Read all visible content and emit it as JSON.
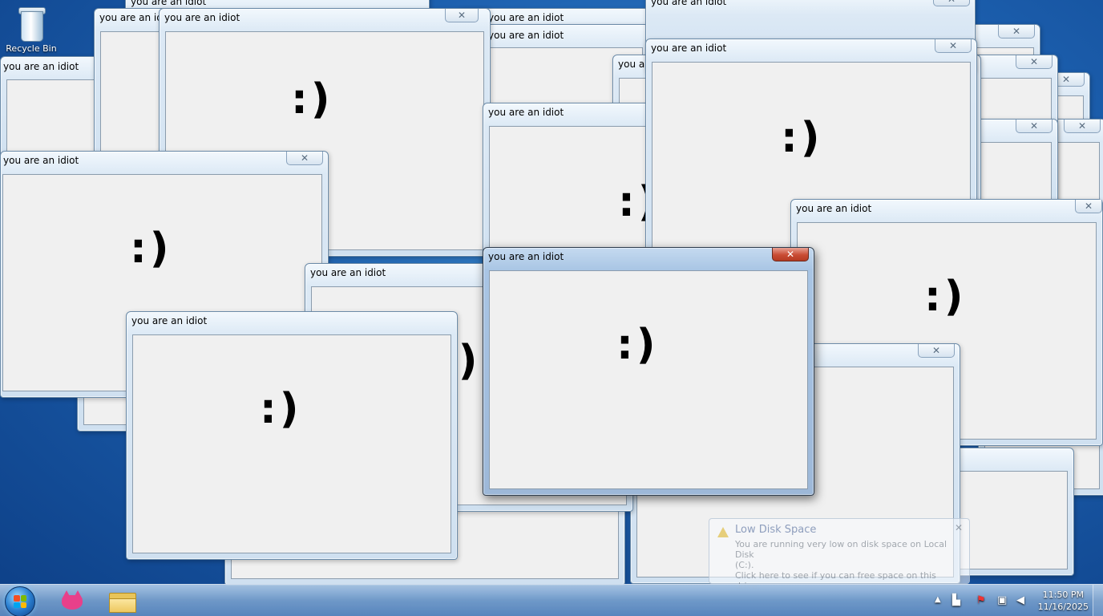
{
  "desktop": {
    "icons": [
      {
        "label": "Recycle Bin",
        "icon": "recycle-bin-icon"
      }
    ]
  },
  "window_title": "you are an idiot",
  "smiley": ":)",
  "close_glyph": "✕",
  "notification": {
    "title": "Low Disk Space",
    "line1": "You are running very low on disk space on Local Disk",
    "line2": "(C:).",
    "line3": "Click here to see if you can free space on this drive.",
    "icon": "warning-icon"
  },
  "taskbar": {
    "start_icon": "windows-logo-icon",
    "pinned": [
      {
        "icon": "pink-fox-app-icon"
      },
      {
        "icon": "file-explorer-icon"
      }
    ],
    "tray": {
      "show_hidden": "▲",
      "icons": [
        "network-printer-icon",
        "action-center-flag-icon",
        "network-icon",
        "volume-muted-icon"
      ],
      "time": "11:50 PM",
      "date": "11/16/2025"
    }
  },
  "colors": {
    "accent_close": "#c94c34",
    "desktop_blue": "#1c5fae"
  }
}
